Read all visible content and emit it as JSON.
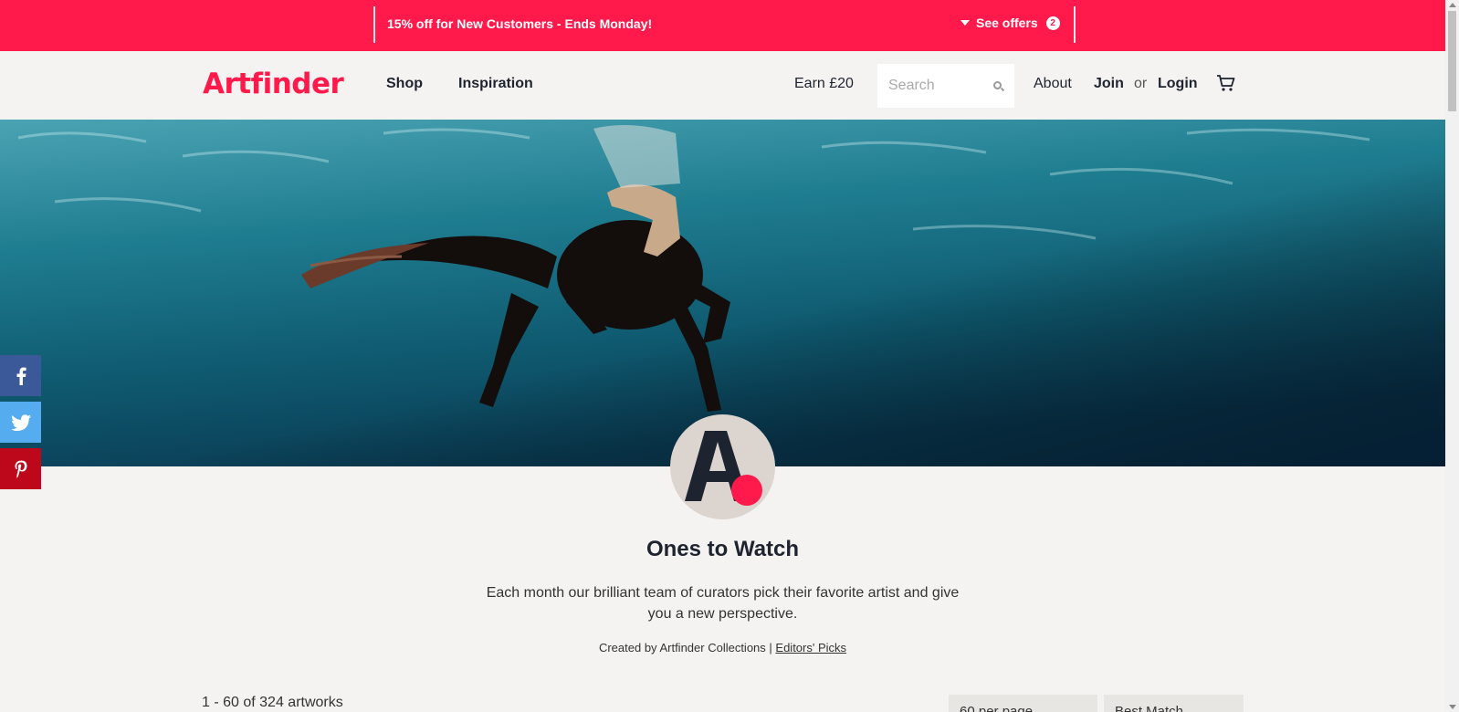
{
  "promo": {
    "text": "15% off for New Customers - Ends Monday!",
    "offers_label": "See offers",
    "offers_count": "2"
  },
  "header": {
    "logo": "Artfinder",
    "nav": [
      "Shop",
      "Inspiration"
    ],
    "earn": "Earn £20",
    "search_placeholder": "Search",
    "about": "About",
    "join": "Join",
    "or": "or",
    "login": "Login"
  },
  "collection": {
    "title": "Ones to Watch",
    "description": "Each month our brilliant team of curators pick their favorite artist and give you a new perspective.",
    "credit_prefix": "Created by Artfinder Collections |",
    "credit_link": "Editors' Picks"
  },
  "results": {
    "count": "1 - 60 of 324 artworks",
    "per_page": "60 per page",
    "sort": "Best Match"
  },
  "colors": {
    "brand": "#ff1a4b",
    "facebook": "#3b5998",
    "twitter": "#55acee",
    "pinterest": "#bd081c"
  },
  "icons": {
    "search": "search-icon",
    "cart": "cart-icon",
    "facebook": "facebook-icon",
    "twitter": "twitter-icon",
    "pinterest": "pinterest-icon",
    "caret": "caret-down-icon"
  }
}
